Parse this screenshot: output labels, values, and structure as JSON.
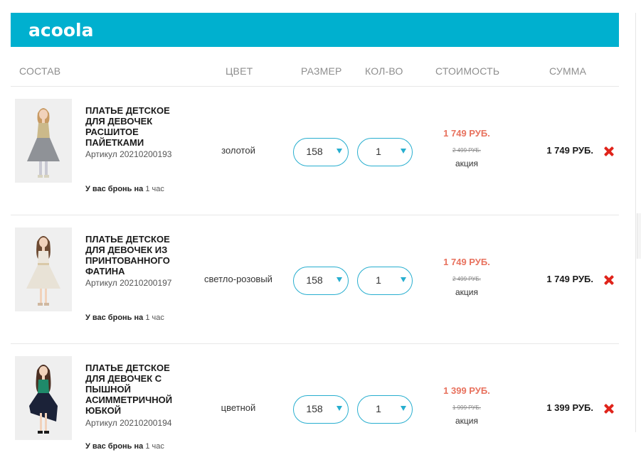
{
  "header": {
    "logo_text": "acoola",
    "bg_color": "#00b0cf"
  },
  "columns": {
    "composition": "СОСТАВ",
    "color": "ЦВЕТ",
    "size": "РАЗМЕР",
    "quantity": "КОЛ-ВО",
    "cost": "СТОИМОСТЬ",
    "sum": "СУММА"
  },
  "items": [
    {
      "name": "ПЛАТЬЕ ДЕТСКОЕ ДЛЯ ДЕВОЧЕК РАСШИТОЕ ПАЙЕТКАМИ",
      "article": "Артикул 20210200193",
      "reserve_label": "У вас бронь на",
      "reserve_num": "1",
      "reserve_unit": "час",
      "color": "золотой",
      "size": "158",
      "qty": "1",
      "price_new": "1 749 РУБ.",
      "price_old": "2 499 РУБ.",
      "promo": "акция",
      "total": "1 749 РУБ.",
      "thumb_icon": "dress-sequin-gold-photo"
    },
    {
      "name": "ПЛАТЬЕ ДЕТСКОЕ ДЛЯ ДЕВОЧЕК ИЗ ПРИНТОВАННОГО ФАТИНА",
      "article": "Артикул 20210200197",
      "reserve_label": "У вас бронь на",
      "reserve_num": "1",
      "reserve_unit": "час",
      "color": "светло-розовый",
      "size": "158",
      "qty": "1",
      "price_new": "1 749 РУБ.",
      "price_old": "2 499 РУБ.",
      "promo": "акция",
      "total": "1 749 РУБ.",
      "thumb_icon": "dress-tulle-pink-photo"
    },
    {
      "name": "ПЛАТЬЕ ДЕТСКОЕ ДЛЯ ДЕВОЧЕК С ПЫШНОЙ АСИММЕТРИЧНОЙ ЮБКОЙ",
      "article": "Артикул 20210200194",
      "reserve_label": "У вас бронь на",
      "reserve_num": "1",
      "reserve_unit": "час",
      "color": "цветной",
      "size": "158",
      "qty": "1",
      "price_new": "1 399 РУБ.",
      "price_old": "1 999 РУБ.",
      "promo": "акция",
      "total": "1 399 РУБ.",
      "thumb_icon": "dress-asymmetric-navy-photo"
    }
  ],
  "colors": {
    "accent": "#27aecf",
    "sale_price": "#e8725e",
    "remove": "#e0241b"
  }
}
